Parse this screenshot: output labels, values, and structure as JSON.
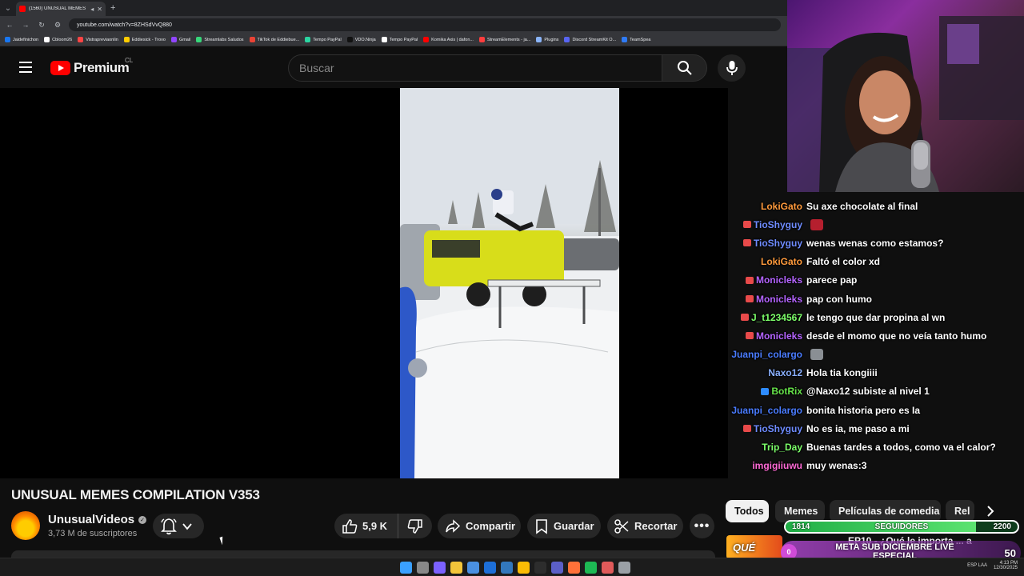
{
  "browser": {
    "tab_title": "(1560) UNUSUAL MEMES C",
    "url": "youtube.com/watch?v=8ZHSdVvQ880",
    "bookmarks": [
      "Jaidefinichon",
      "Cbloom26",
      "Vistrapreviaonlin",
      "Eddiesick - Trovo",
      "Gmail",
      "Streamlabs Saludos",
      "TikTok de Eddiebue...",
      "Tempo PayPal",
      "VDO.Ninja",
      "Tempo PayPal",
      "Komika Axis | dafon...",
      "StreamElements - ja...",
      "Plugins",
      "Discord StreamKit O...",
      "TeamSpea"
    ]
  },
  "masthead": {
    "logo_text": "Premium",
    "country": "CL",
    "search_placeholder": "Buscar"
  },
  "video": {
    "title": "UNUSUAL MEMES COMPILATION V353",
    "channel": "UnusualVideos",
    "subscribers": "3,73 M de suscriptores",
    "likes": "5,9 K",
    "share_label": "Compartir",
    "save_label": "Guardar",
    "clip_label": "Recortar"
  },
  "chat": [
    {
      "user": "LokiGato",
      "color": "#ff9a3c",
      "badge": "",
      "msg": "Su axe chocolate al final"
    },
    {
      "user": "TioShyguy",
      "color": "#6f8cff",
      "badge": "#e84a4a",
      "msg": "",
      "emote": "#b51f2e"
    },
    {
      "user": "TioShyguy",
      "color": "#6f8cff",
      "badge": "#e84a4a",
      "msg": "wenas wenas como estamos?"
    },
    {
      "user": "LokiGato",
      "color": "#ff9a3c",
      "badge": "",
      "msg": "Faltó el color xd"
    },
    {
      "user": "Monicleks",
      "color": "#b464ff",
      "badge": "#e84a4a",
      "msg": "parece pap"
    },
    {
      "user": "Monicleks",
      "color": "#b464ff",
      "badge": "#e84a4a",
      "msg": "pap con humo"
    },
    {
      "user": "J_t1234567",
      "color": "#7dff6a",
      "badge": "#e84a4a",
      "msg": "le tengo que dar propina al wn"
    },
    {
      "user": "Monicleks",
      "color": "#b464ff",
      "badge": "#e84a4a",
      "msg": "desde el momo que no veía tanto humo"
    },
    {
      "user": "Juanpi_colargo",
      "color": "#4a7cff",
      "badge": "",
      "msg": "",
      "emote": "#8a8f94"
    },
    {
      "user": "Naxo12",
      "color": "#8ab0ff",
      "badge": "",
      "msg": "Hola tia kongiiii"
    },
    {
      "user": "BotRix",
      "color": "#66e34a",
      "badge": "#2e8cff",
      "msg": "@Naxo12 subiste al nivel 1"
    },
    {
      "user": "Juanpi_colargo",
      "color": "#4a7cff",
      "badge": "",
      "msg": "bonita historia pero es Ia"
    },
    {
      "user": "TioShyguy",
      "color": "#6f8cff",
      "badge": "#e84a4a",
      "msg": "No es ia, me paso a mi"
    },
    {
      "user": "Trip_Day",
      "color": "#7dff6a",
      "badge": "",
      "msg": "Buenas tardes a todos, como va el calor?"
    },
    {
      "user": "imgigiiuwu",
      "color": "#ff6ad5",
      "badge": "",
      "msg": "muy wenas:3"
    }
  ],
  "chips": [
    {
      "label": "Todos",
      "active": true
    },
    {
      "label": "Memes",
      "active": false
    },
    {
      "label": "Películas de comedia",
      "active": false
    },
    {
      "label": "Rel",
      "active": false
    }
  ],
  "followers_goal": {
    "current": "1814",
    "label": "SEGUIDORES",
    "target": "2200",
    "progress": 0.82
  },
  "sub_goal": {
    "current": "0",
    "label": "META SUB DICIEMBRE LIVE ESPECIAL",
    "target": "50"
  },
  "recommended": {
    "thumb_text": "QUÉ",
    "title": "EP10 - ¿Qué le importa ... a"
  },
  "taskbar": {
    "lang": "ESP LAA",
    "time": "4:13 PM",
    "date": "12/30/2025"
  },
  "colors": {
    "background": "#0f0f0f",
    "accent": "#ff0000",
    "pill": "#272727"
  }
}
